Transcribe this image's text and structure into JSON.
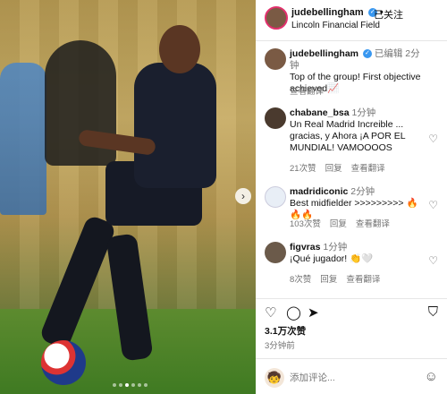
{
  "post": {
    "author": "judebellingham",
    "follow_label": "已关注",
    "location": "Lincoln Financial Field",
    "separator": "•"
  },
  "caption": {
    "author": "judebellingham",
    "edited_label": "已编辑",
    "time": "2分钟",
    "text": "Top of the group! First objective achieved📈",
    "translate_label": "查看翻译"
  },
  "comments": [
    {
      "author": "chabane_bsa",
      "time": "1分钟",
      "text": "Un Real Madrid Increible ... gracias, y Ahora ¡A POR EL MUNDIAL! VAMOOOOS",
      "likes": "21次赞",
      "reply_label": "回复",
      "translate_label": "查看翻译"
    },
    {
      "author": "madridiconic",
      "time": "2分钟",
      "text": "Best midfielder >>>>>>>>> 🔥🔥🔥",
      "likes": "103次赞",
      "reply_label": "回复",
      "translate_label": "查看翻译"
    },
    {
      "author": "figvras",
      "time": "1分钟",
      "text": "¡Qué jugador! 👏🤍",
      "likes": "8次赞",
      "reply_label": "回复",
      "translate_label": "查看翻译"
    }
  ],
  "stats": {
    "likes": "3.1万次赞",
    "posted_ago": "3分钟前"
  },
  "composer": {
    "placeholder": "添加评论..."
  },
  "icons": {
    "like": "heart-icon",
    "comment": "comment-bubble-icon",
    "share": "paper-plane-icon",
    "save": "bookmark-icon",
    "emoji": "smile-icon",
    "verified": "verified-badge-icon",
    "next": "chevron-right-icon"
  },
  "colors": {
    "verified": "#3897f0",
    "story_ring": "#e1306c",
    "muted_text": "#737373"
  },
  "carousel": {
    "total_slides": 6,
    "current_slide": 3
  }
}
